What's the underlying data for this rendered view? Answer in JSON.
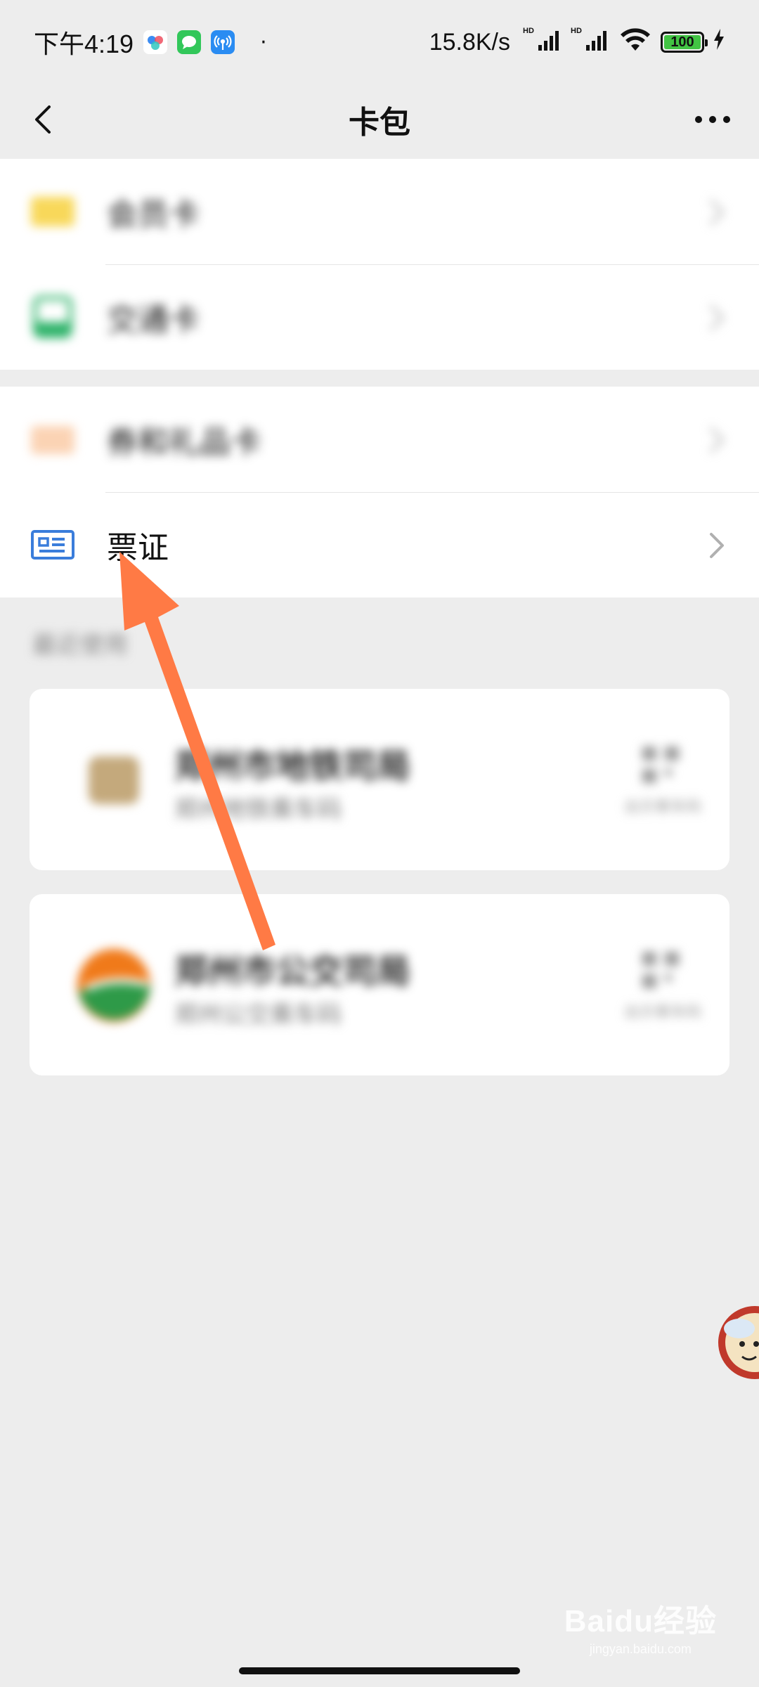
{
  "status_bar": {
    "time": "下午4:19",
    "dot": "·",
    "net_speed": "15.8K/s",
    "hd_label": "HD",
    "battery_level": "100",
    "battery_color": "#42c444"
  },
  "nav": {
    "title": "卡包"
  },
  "groups": [
    {
      "items": [
        {
          "label": "会员卡",
          "blurred": true
        },
        {
          "label": "交通卡",
          "blurred": true
        }
      ]
    },
    {
      "items": [
        {
          "label": "券和礼品卡",
          "blurred": true
        },
        {
          "label": "票证",
          "blurred": false
        }
      ]
    }
  ],
  "recent": {
    "header": "最近使用",
    "cards": [
      {
        "name": "郑州市地铁司局",
        "subtitle": "郑州地铁乘车码",
        "qr_label": "出示乘车码"
      },
      {
        "name": "郑州市公交司局",
        "subtitle": "郑州公交乘车码",
        "qr_label": "出示乘车码"
      }
    ]
  },
  "annotation": {
    "arrow_color": "#ff7a45",
    "points_to": "tickets"
  },
  "watermark": {
    "main": "Baidu经验",
    "sub": "jingyan.baidu.com"
  }
}
